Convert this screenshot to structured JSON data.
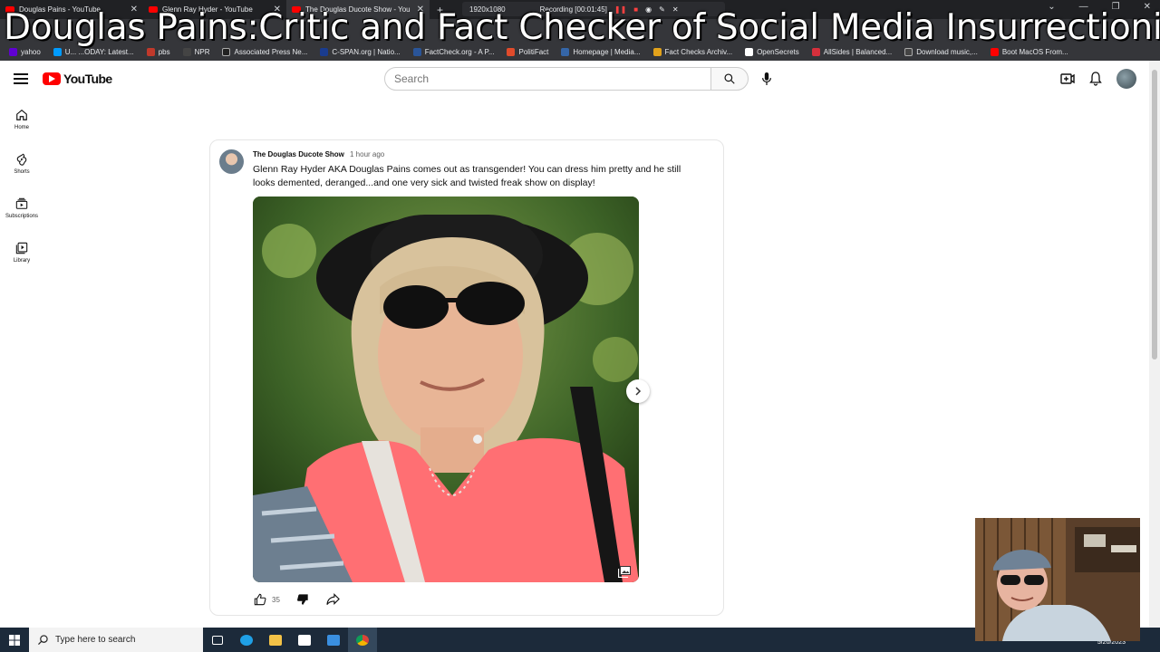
{
  "overlay_title": "Douglas Pains:Critic and Fact Checker of Social Media Insurrectionist",
  "browser": {
    "tabs": [
      {
        "title": "Douglas Pains - YouTube",
        "active": false
      },
      {
        "title": "Glenn Ray Hyder - YouTube",
        "active": false
      },
      {
        "title": "The Douglas Ducote Show - You",
        "active": true
      }
    ],
    "new_tab": "+",
    "recorder": {
      "resolution": "1920x1080",
      "status": "Recording [00:01:45]"
    },
    "bookmarks": [
      {
        "label": "yahoo",
        "color": "#6001d2"
      },
      {
        "label": "U... ...ODAY: Latest...",
        "color": "#009bff"
      },
      {
        "label": "pbs",
        "color": "#c0392b"
      },
      {
        "label": "NPR",
        "color": "#444444"
      },
      {
        "label": "Associated Press Ne...",
        "color": "#222222"
      },
      {
        "label": "C-SPAN.org | Natio...",
        "color": "#1a3c8f"
      },
      {
        "label": "FactCheck.org - A P...",
        "color": "#2a5599"
      },
      {
        "label": "PolitiFact",
        "color": "#e04b2b"
      },
      {
        "label": "Homepage | Media...",
        "color": "#3566a8"
      },
      {
        "label": "Fact Checks Archiv...",
        "color": "#e2a21b"
      },
      {
        "label": "OpenSecrets",
        "color": "#ffffff"
      },
      {
        "label": "AllSides | Balanced...",
        "color": "#d6303c"
      },
      {
        "label": "Download music,...",
        "color": "#444444"
      },
      {
        "label": "Boot MacOS From...",
        "color": "#ff0000"
      }
    ]
  },
  "youtube": {
    "logo_text": "YouTube",
    "search_placeholder": "Search",
    "sidebar": [
      {
        "label": "Home",
        "icon": "home-icon"
      },
      {
        "label": "Shorts",
        "icon": "shorts-icon"
      },
      {
        "label": "Subscriptions",
        "icon": "subscriptions-icon"
      },
      {
        "label": "Library",
        "icon": "library-icon"
      }
    ]
  },
  "post": {
    "channel": "The Douglas Ducote Show",
    "time": "1 hour ago",
    "text": "Glenn Ray Hyder AKA Douglas Pains comes out as transgender! You can dress him pretty and he still looks demented, deranged...and one very sick and twisted freak show on display!",
    "likes": "35"
  },
  "taskbar": {
    "search_placeholder": "Type here to search",
    "date": "5/20/2023"
  },
  "colors": {
    "youtube_red": "#ff0000",
    "tabbar": "#202124",
    "taskbar": "#1c2a3a"
  }
}
